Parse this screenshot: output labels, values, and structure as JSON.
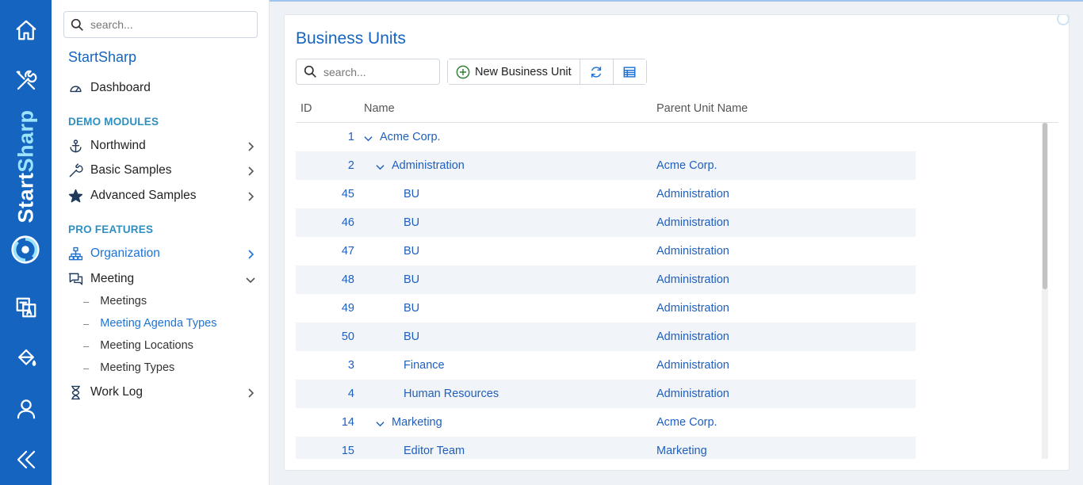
{
  "rail": {
    "brand_part1": "Start",
    "brand_part2": "Sharp",
    "buttons": [
      {
        "icon": "home-icon"
      },
      {
        "icon": "tools-icon"
      },
      {
        "icon": "translate-icon"
      },
      {
        "icon": "paint-bucket-icon"
      },
      {
        "icon": "user-icon"
      },
      {
        "icon": "collapse-icon"
      }
    ]
  },
  "sidebar": {
    "search_placeholder": "search...",
    "brand": "StartSharp",
    "dashboard": "Dashboard",
    "section_demo": "DEMO MODULES",
    "northwind": "Northwind",
    "basic_samples": "Basic Samples",
    "advanced_samples": "Advanced Samples",
    "section_pro": "PRO FEATURES",
    "organization": "Organization",
    "meeting": "Meeting",
    "meeting_sub": [
      "Meetings",
      "Meeting Agenda Types",
      "Meeting Locations",
      "Meeting Types"
    ],
    "work_log": "Work Log"
  },
  "page": {
    "title": "Business Units",
    "search_placeholder": "search...",
    "new_button": "New Business Unit"
  },
  "grid": {
    "columns": {
      "id": "ID",
      "name": "Name",
      "parent": "Parent Unit Name"
    },
    "rows": [
      {
        "id": "1",
        "name": "Acme Corp.",
        "parent": "",
        "level": 0,
        "expandable": true
      },
      {
        "id": "2",
        "name": "Administration",
        "parent": "Acme Corp.",
        "level": 1,
        "expandable": true
      },
      {
        "id": "45",
        "name": "BU",
        "parent": "Administration",
        "level": 2,
        "expandable": false
      },
      {
        "id": "46",
        "name": "BU",
        "parent": "Administration",
        "level": 2,
        "expandable": false
      },
      {
        "id": "47",
        "name": "BU",
        "parent": "Administration",
        "level": 2,
        "expandable": false
      },
      {
        "id": "48",
        "name": "BU",
        "parent": "Administration",
        "level": 2,
        "expandable": false
      },
      {
        "id": "49",
        "name": "BU",
        "parent": "Administration",
        "level": 2,
        "expandable": false
      },
      {
        "id": "50",
        "name": "BU",
        "parent": "Administration",
        "level": 2,
        "expandable": false
      },
      {
        "id": "3",
        "name": "Finance",
        "parent": "Administration",
        "level": 2,
        "expandable": false
      },
      {
        "id": "4",
        "name": "Human Resources",
        "parent": "Administration",
        "level": 2,
        "expandable": false
      },
      {
        "id": "14",
        "name": "Marketing",
        "parent": "Acme Corp.",
        "level": 1,
        "expandable": true
      },
      {
        "id": "15",
        "name": "Editor Team",
        "parent": "Marketing",
        "level": 2,
        "expandable": false
      }
    ]
  },
  "colors": {
    "accent": "#1565c0",
    "link": "#1e5fc0",
    "section": "#2f8fc0"
  }
}
